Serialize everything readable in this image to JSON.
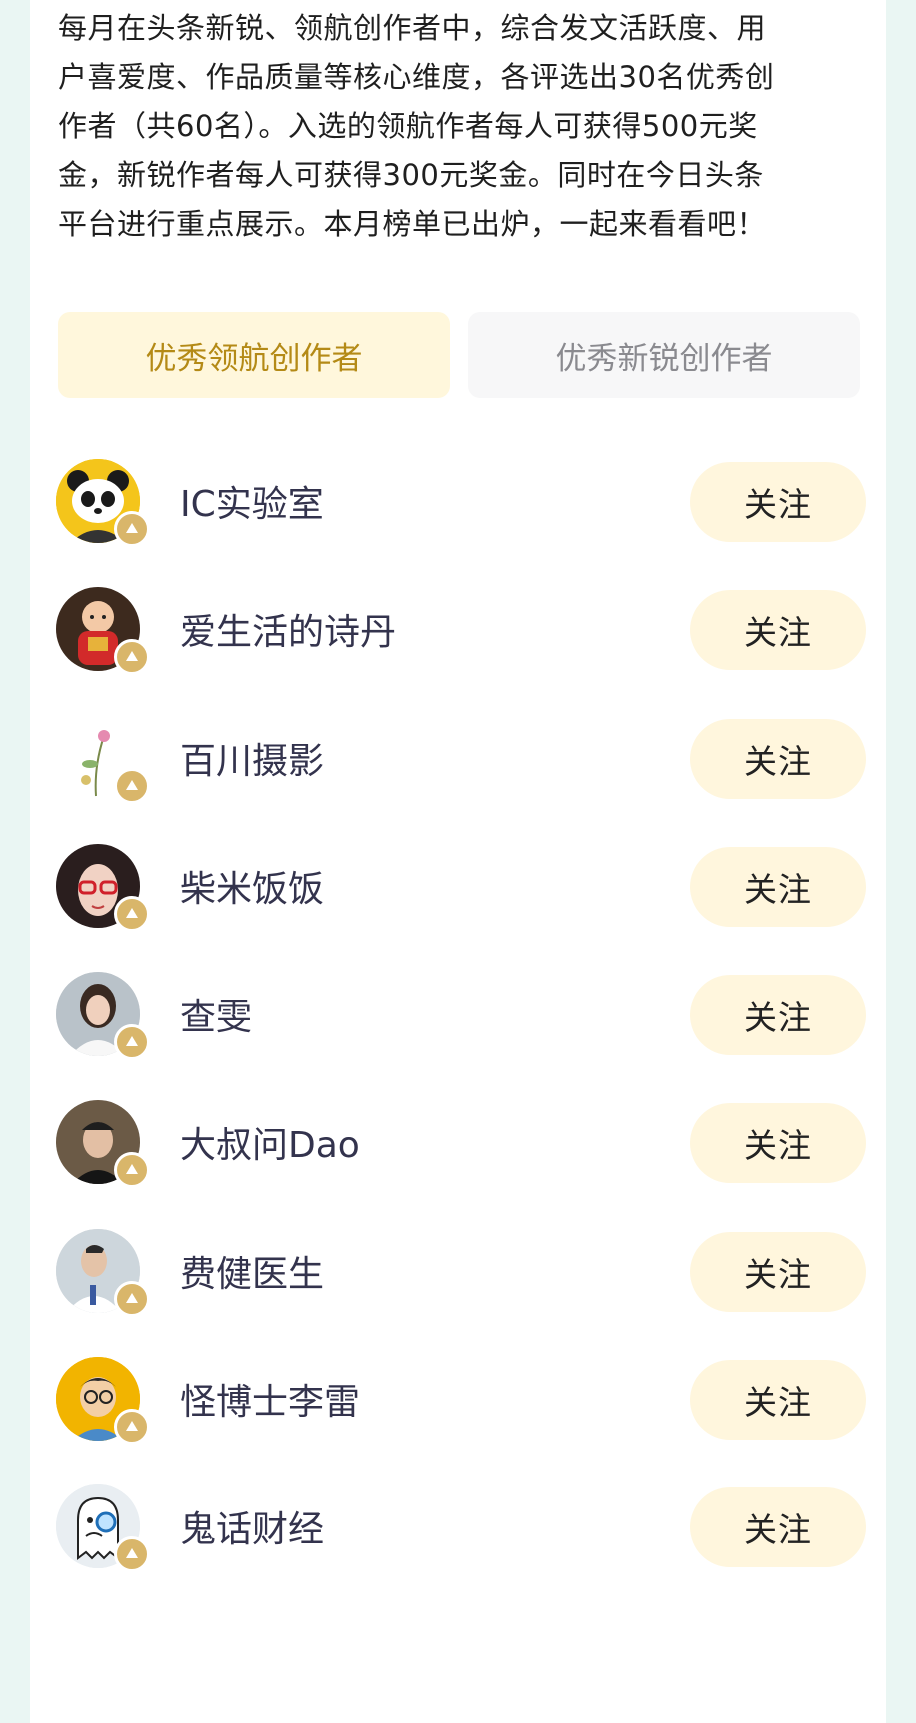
{
  "intro": {
    "lines": [
      "每月在头条新锐、领航创作者中，综合发文活跃度、用",
      "户喜爱度、作品质量等核心维度，各评选出30名优秀创",
      "作者（共60名）。入选的领航作者每人可获得500元奖",
      "金，新锐作者每人可获得300元奖金。同时在今日头条",
      "平台进行重点展示。本月榜单已出炉，一起来看看吧！"
    ]
  },
  "tabs": [
    {
      "label": "优秀领航创作者",
      "active": true
    },
    {
      "label": "优秀新锐创作者",
      "active": false
    }
  ],
  "follow_label": "关注",
  "creators": [
    {
      "name": "IC实验室",
      "avatar": "panda-avatar"
    },
    {
      "name": "爱生活的诗丹",
      "avatar": "doll-avatar"
    },
    {
      "name": "百川摄影",
      "avatar": "flower-avatar"
    },
    {
      "name": "柴米饭饭",
      "avatar": "glasses-woman-avatar"
    },
    {
      "name": "查雯",
      "avatar": "woman-portrait-avatar"
    },
    {
      "name": "大叔问Dao",
      "avatar": "man-cap-avatar"
    },
    {
      "name": "费健医生",
      "avatar": "doctor-avatar"
    },
    {
      "name": "怪博士李雷",
      "avatar": "cartoon-doctor-avatar"
    },
    {
      "name": "鬼话财经",
      "avatar": "ghost-avatar"
    }
  ],
  "colors": {
    "accent_text": "#b48a16",
    "active_tab_bg": "#fff7dc",
    "follow_bg": "#fff6dd",
    "badge": "#d9b66a",
    "page_bg": "#eaf6f3"
  }
}
